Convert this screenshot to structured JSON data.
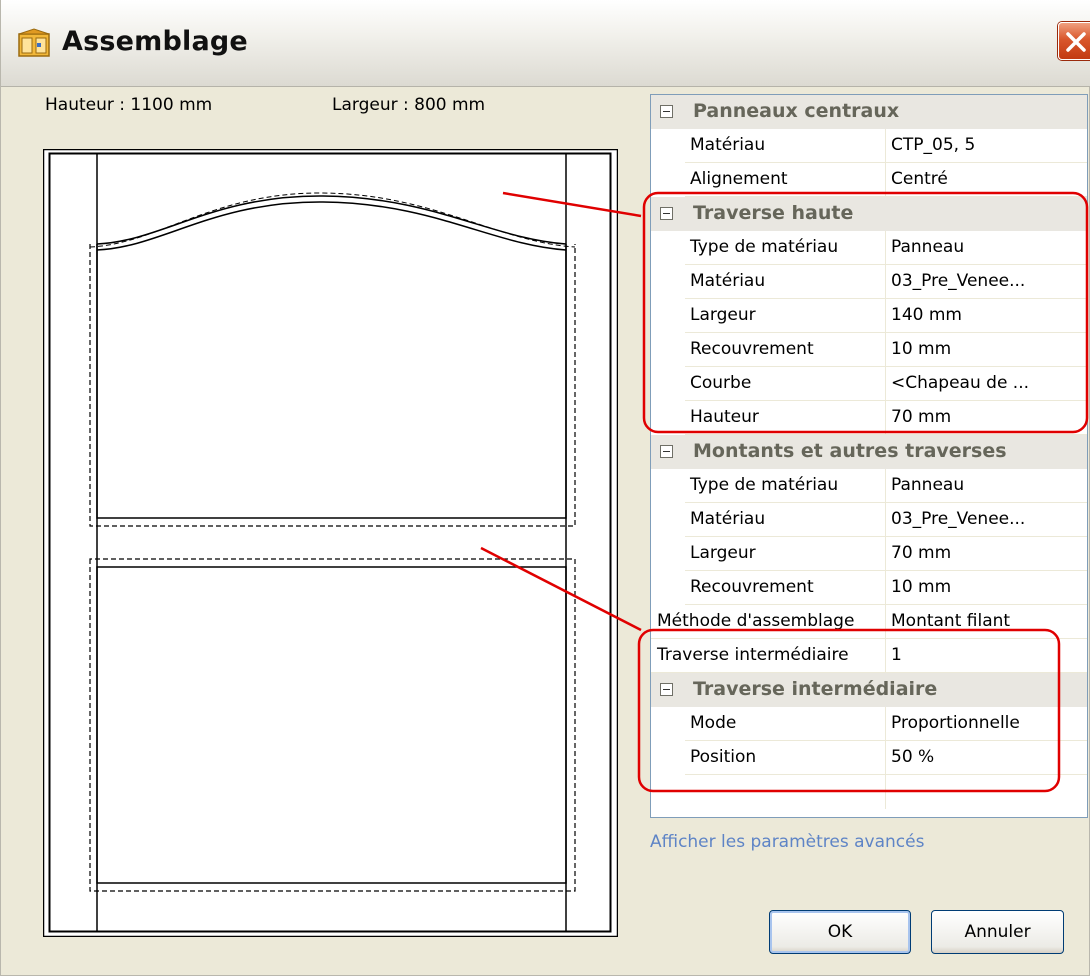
{
  "window": {
    "title": "Assemblage",
    "icon": "cabinet-door-icon",
    "close_icon": "close-icon"
  },
  "dimensions": {
    "height_label": "Hauteur : 1100 mm",
    "width_label": "Largeur : 800 mm"
  },
  "properties": [
    {
      "type": "category",
      "label": "Panneaux centraux"
    },
    {
      "type": "prop",
      "key": "Matériau",
      "value": "CTP_05, 5"
    },
    {
      "type": "prop",
      "key": "Alignement",
      "value": "Centré"
    },
    {
      "type": "category",
      "label": "Traverse haute"
    },
    {
      "type": "prop",
      "key": "Type de matériau",
      "value": "Panneau"
    },
    {
      "type": "prop",
      "key": "Matériau",
      "value": "03_Pre_Venee..."
    },
    {
      "type": "prop",
      "key": "Largeur",
      "value": "140 mm"
    },
    {
      "type": "prop",
      "key": "Recouvrement",
      "value": "10 mm"
    },
    {
      "type": "prop",
      "key": "Courbe",
      "value": "<Chapeau de ..."
    },
    {
      "type": "prop",
      "key": "Hauteur",
      "value": "70 mm"
    },
    {
      "type": "category",
      "label": "Montants et autres traverses"
    },
    {
      "type": "prop",
      "key": "Type de matériau",
      "value": "Panneau"
    },
    {
      "type": "prop",
      "key": "Matériau",
      "value": "03_Pre_Venee..."
    },
    {
      "type": "prop",
      "key": "Largeur",
      "value": "70 mm"
    },
    {
      "type": "prop",
      "key": "Recouvrement",
      "value": "10 mm"
    },
    {
      "type": "top",
      "key": "Méthode d'assemblage",
      "value": "Montant filant"
    },
    {
      "type": "top",
      "key": "Traverse intermédiaire",
      "value": "1"
    },
    {
      "type": "category",
      "label": "Traverse intermédiaire"
    },
    {
      "type": "prop",
      "key": "Mode",
      "value": "Proportionnelle"
    },
    {
      "type": "prop",
      "key": "Position",
      "value": "50 %"
    },
    {
      "type": "blank",
      "key": "",
      "value": ""
    }
  ],
  "links": {
    "advanced": "Afficher les paramètres avancés"
  },
  "buttons": {
    "ok": "OK",
    "cancel": "Annuler"
  },
  "colors": {
    "highlight": "#e00000",
    "category_text": "#66665a",
    "link": "#5e84c6"
  }
}
